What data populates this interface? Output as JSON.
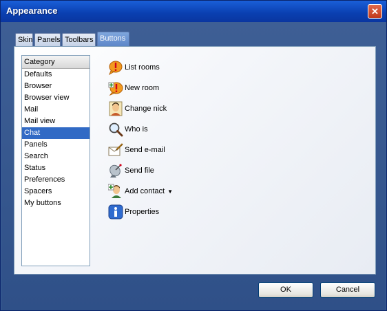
{
  "window": {
    "title": "Appearance"
  },
  "tabs": [
    {
      "label": "Skin"
    },
    {
      "label": "Panels"
    },
    {
      "label": "Toolbars"
    },
    {
      "label": "Buttons"
    }
  ],
  "categories": {
    "header": "Category",
    "items": [
      "Defaults",
      "Browser",
      "Browser view",
      "Mail",
      "Mail view",
      "Chat",
      "Panels",
      "Search",
      "Status",
      "Preferences",
      "Spacers",
      "My buttons"
    ],
    "selected": "Chat"
  },
  "buttons": [
    {
      "label": "List rooms",
      "icon": "list-rooms-icon"
    },
    {
      "label": "New room",
      "icon": "new-room-icon"
    },
    {
      "label": "Change nick",
      "icon": "change-nick-icon"
    },
    {
      "label": "Who is",
      "icon": "magnifier-icon"
    },
    {
      "label": "Send e-mail",
      "icon": "send-email-icon"
    },
    {
      "label": "Send file",
      "icon": "send-file-icon"
    },
    {
      "label": "Add contact",
      "icon": "add-contact-icon"
    },
    {
      "label": "Properties",
      "icon": "properties-icon"
    }
  ],
  "footer": {
    "ok_label": "OK",
    "cancel_label": "Cancel"
  },
  "colors": {
    "titlebar": "#0a3fb0",
    "selection": "#316ac5",
    "close": "#c0391c"
  }
}
